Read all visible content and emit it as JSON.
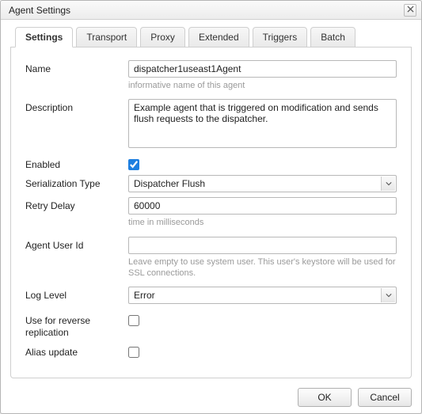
{
  "dialog": {
    "title": "Agent Settings"
  },
  "tabs": [
    {
      "label": "Settings"
    },
    {
      "label": "Transport"
    },
    {
      "label": "Proxy"
    },
    {
      "label": "Extended"
    },
    {
      "label": "Triggers"
    },
    {
      "label": "Batch"
    }
  ],
  "form": {
    "name": {
      "label": "Name",
      "value": "dispatcher1useast1Agent",
      "hint": "informative name of this agent"
    },
    "description": {
      "label": "Description",
      "value": "Example agent that is triggered on modification and sends flush requests to the dispatcher."
    },
    "enabled": {
      "label": "Enabled",
      "checked": true
    },
    "serializationType": {
      "label": "Serialization Type",
      "value": "Dispatcher Flush"
    },
    "retryDelay": {
      "label": "Retry Delay",
      "value": "60000",
      "hint": "time in milliseconds"
    },
    "agentUserId": {
      "label": "Agent User Id",
      "value": "",
      "hint": "Leave empty to use system user. This user's keystore will be used for SSL connections."
    },
    "logLevel": {
      "label": "Log Level",
      "value": "Error"
    },
    "useForReverseReplication": {
      "label": "Use for reverse replication",
      "checked": false
    },
    "aliasUpdate": {
      "label": "Alias update",
      "checked": false
    }
  },
  "buttons": {
    "ok": "OK",
    "cancel": "Cancel"
  }
}
